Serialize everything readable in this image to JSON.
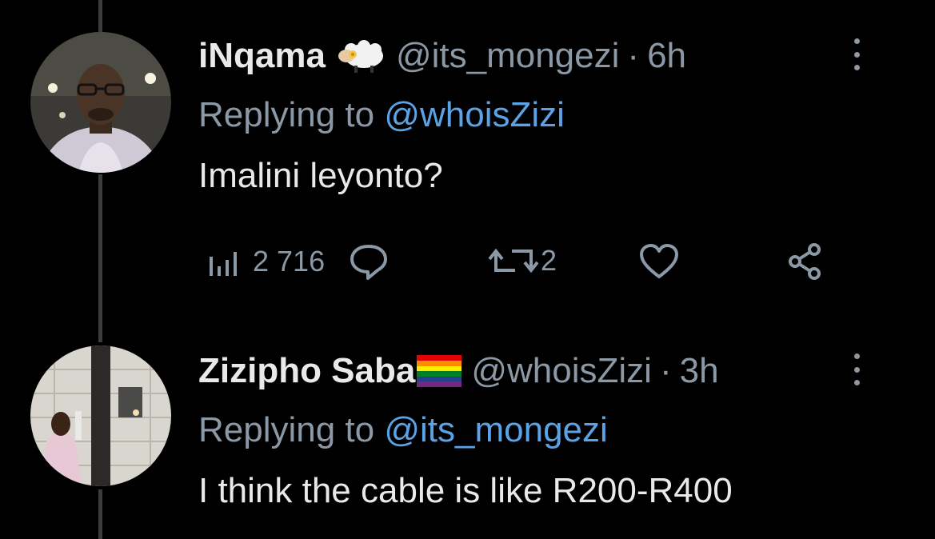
{
  "tweets": [
    {
      "display_name": "iNqama",
      "handle": "@its_mongezi",
      "separator": "·",
      "time": "6h",
      "replying_prefix": "Replying to ",
      "replying_to": "@whoisZizi",
      "text": "Imalini leyonto?",
      "badge_icon": "sheep-emoji-icon",
      "actions": {
        "views": "2 716",
        "retweets": "2"
      }
    },
    {
      "display_name": "Zizipho Saba",
      "handle": "@whoisZizi",
      "separator": "·",
      "time": "3h",
      "replying_prefix": "Replying to ",
      "replying_to": "@its_mongezi",
      "text": "I think the cable is like R200-R400",
      "badge_icon": "rainbow-flag-emoji-icon"
    }
  ],
  "colors": {
    "background": "#000000",
    "text": "#e7e9ea",
    "muted": "#8b98a5",
    "link": "#5ba3e7",
    "thread_line": "#3a3d40"
  }
}
